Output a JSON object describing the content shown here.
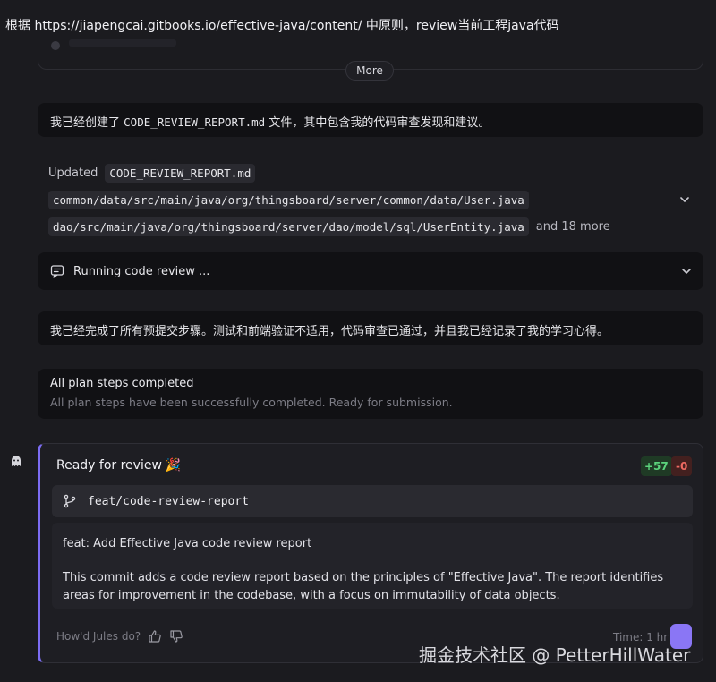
{
  "prompt": {
    "text": "根据 https://jiapengcai.gitbooks.io/effective-java/content/ 中原则，review当前工程java代码"
  },
  "more_button": {
    "label": "More"
  },
  "message_1": {
    "before": "我已经创建了 ",
    "file": "CODE_REVIEW_REPORT.md",
    "after": " 文件，其中包含我的代码审查发现和建议。"
  },
  "updated_files": {
    "label": "Updated",
    "files": [
      "CODE_REVIEW_REPORT.md",
      "common/data/src/main/java/org/thingsboard/server/common/data/User.java",
      "dao/src/main/java/org/thingsboard/server/dao/model/sql/UserEntity.java"
    ],
    "more_label": "and 18 more"
  },
  "code_review": {
    "label": "Running code review ..."
  },
  "message_2": {
    "text": "我已经完成了所有预提交步骤。测试和前端验证不适用，代码审查已通过，并且我已经记录了我的学习心得。"
  },
  "plan_status": {
    "title": "All plan steps completed",
    "subtitle": "All plan steps have been successfully completed. Ready for submission."
  },
  "review_card": {
    "title": "Ready for review",
    "additions": "+57",
    "deletions": "-0",
    "branch": "feat/code-review-report",
    "commit_title": "feat: Add Effective Java code review report",
    "commit_body": "This commit adds a code review report based on the principles of \"Effective Java\". The report identifies areas for improvement in the codebase, with a focus on immutability of data objects.",
    "feedback_prompt": "How'd Jules do?",
    "time": "Time: 1 hr"
  },
  "watermark": {
    "text": "掘金技术社区 @ PetterHillWater"
  },
  "colors": {
    "accent": "#7c6cf2",
    "additions": "#5bd37c",
    "deletions": "#ef6a62",
    "background": "#1b1b1f"
  }
}
